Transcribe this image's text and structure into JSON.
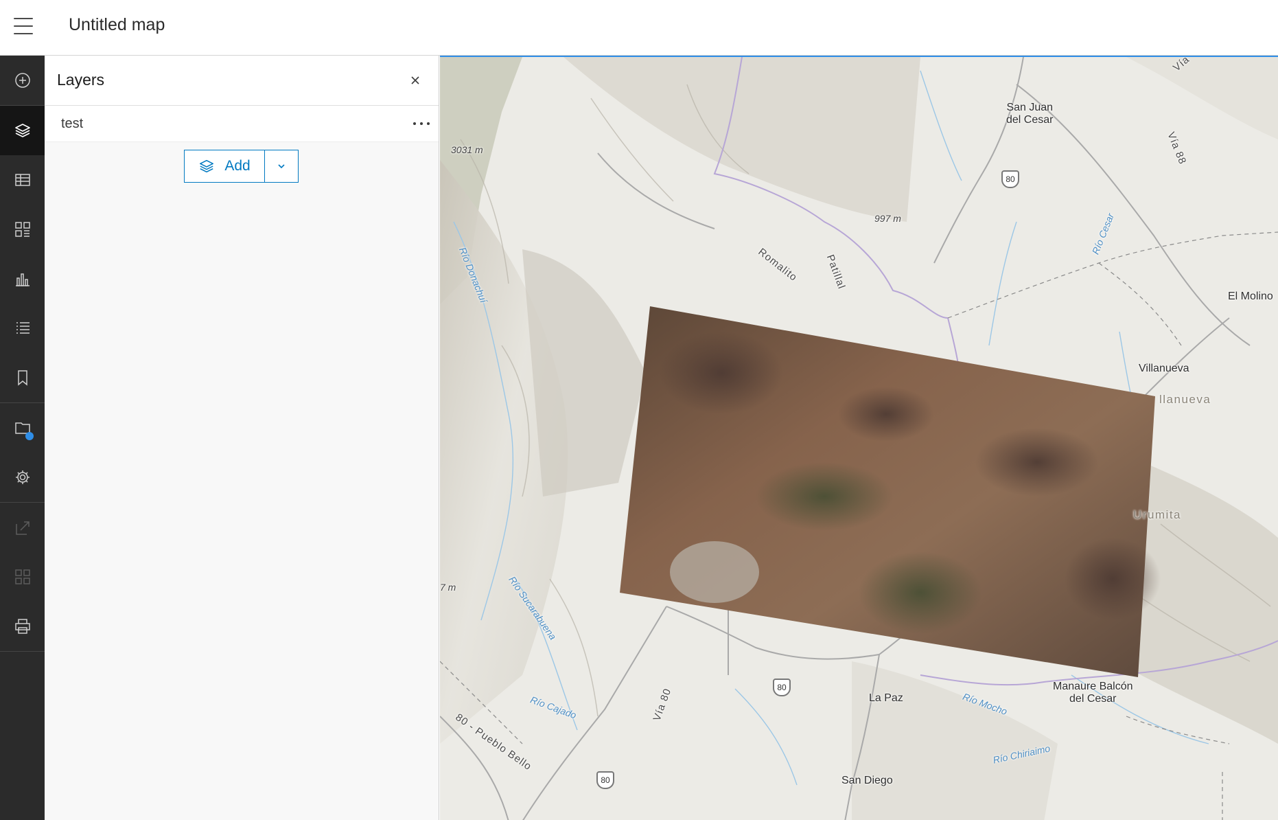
{
  "header": {
    "menu_icon": "hamburger-menu-icon",
    "title": "Untitled map"
  },
  "actionbar": {
    "items": [
      {
        "icon": "add-circle-icon",
        "active": false
      },
      {
        "icon": "layers-icon",
        "active": true
      },
      {
        "icon": "table-icon",
        "active": false
      },
      {
        "icon": "widgets-grid-icon",
        "active": false
      },
      {
        "icon": "bar-chart-icon",
        "active": false
      },
      {
        "icon": "legend-list-icon",
        "active": false
      },
      {
        "icon": "bookmark-icon",
        "active": false
      },
      {
        "icon": "folder-icon",
        "active": false,
        "notification": true
      },
      {
        "icon": "gear-icon",
        "active": false
      },
      {
        "icon": "share-icon",
        "active": false,
        "disabled": true
      },
      {
        "icon": "apps-grid-icon",
        "active": false,
        "disabled": true
      },
      {
        "icon": "print-icon",
        "active": false
      }
    ]
  },
  "panel": {
    "title": "Layers",
    "close_icon": "close-icon",
    "layers": [
      {
        "name": "test"
      }
    ],
    "add_button_label": "Add",
    "add_button_icon": "layers-icon",
    "add_dropdown_icon": "chevron-down-icon"
  },
  "map": {
    "labels": {
      "san_juan": "San Juan\ndel Cesar",
      "via88": "Vía 88",
      "el_molino": "El Molino",
      "villanueva": "Villanueva",
      "villanueva_area": "llanueva",
      "urumita": "Urumita",
      "manaure": "Manaure Balcón\ndel Cesar",
      "la_paz": "La Paz",
      "san_diego": "San Diego",
      "romalito": "Romalito",
      "patillal": "Patillal",
      "rio_donachui": "Río Donachuí",
      "rio_cesar": "Río Cesar",
      "rio_sucarabuena": "Río Sucarabuena",
      "rio_cajado": "Río Cajado",
      "rio_mocho": "Río Mocho",
      "rio_chiriaimo": "Río Chiriaimo",
      "elev_3031": "3031 m",
      "elev_997": "997 m",
      "elev_7": "7 m",
      "via80": "Vía 80",
      "pueblo_bello": "80 - Pueblo Bello",
      "road_top": "Vía",
      "shield_80": "80"
    },
    "colors": {
      "terrain": "#ecebe6",
      "imagery": "#7a5a46",
      "water": "#9cc7e6",
      "boundary": "#b7a6d6"
    }
  }
}
